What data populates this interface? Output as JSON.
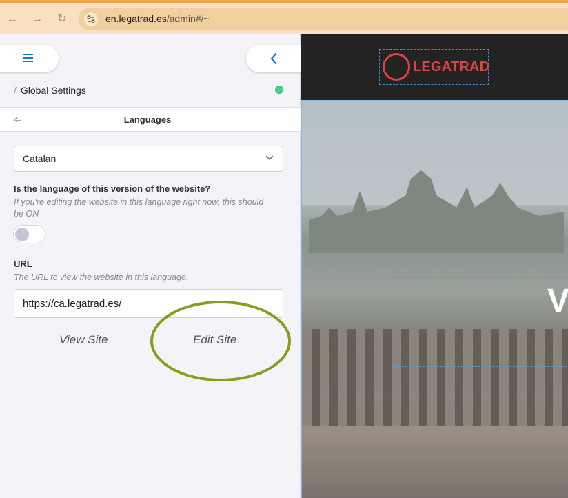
{
  "browser": {
    "url_host": "en.legatrad.es",
    "url_path": "/admin#/~"
  },
  "panel": {
    "breadcrumb_sep": "/",
    "breadcrumb": "Global Settings",
    "section_title": "Languages",
    "section_back_glyph": "⇦"
  },
  "form": {
    "language_value": "Catalan",
    "question_label": "Is the language of this version of the website?",
    "question_help": "If you're editing the website in this language right now, this should be ON",
    "toggle_on": false,
    "url_label": "URL",
    "url_help": "The URL to view the website in this language.",
    "url_value": "https://ca.legatrad.es/",
    "view_site": "View Site",
    "edit_site": "Edit Site"
  },
  "preview": {
    "logo_text": "LEGATRAD",
    "hero_letter": "V"
  },
  "colors": {
    "accent": "#1a73d8",
    "status": "#4fd08a",
    "logo_red": "#d94545",
    "highlight": "#8a9c1c"
  }
}
